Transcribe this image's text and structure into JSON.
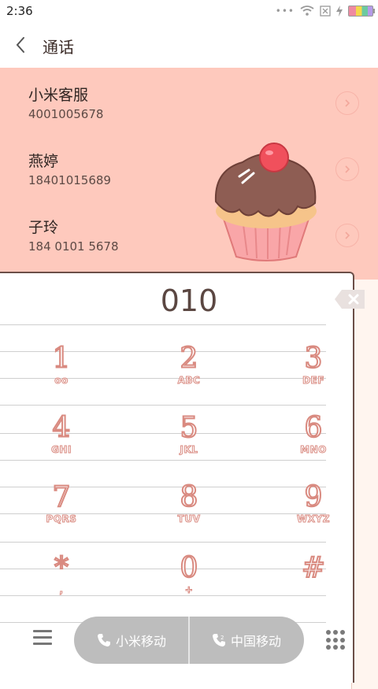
{
  "status_bar": {
    "time": "2:36",
    "more_dots": "•••"
  },
  "header": {
    "title": "通话"
  },
  "suggestions": [
    {
      "name": "小米客服",
      "number": "4001005678"
    },
    {
      "name": "燕婷",
      "number": "18401015689"
    },
    {
      "name": "子玲",
      "number": "184 0101 5678"
    }
  ],
  "dialer": {
    "input": "010",
    "keys": [
      {
        "digit": "1",
        "letters": "oo"
      },
      {
        "digit": "2",
        "letters": "ABC"
      },
      {
        "digit": "3",
        "letters": "DEF"
      },
      {
        "digit": "4",
        "letters": "GHI"
      },
      {
        "digit": "5",
        "letters": "JKL"
      },
      {
        "digit": "6",
        "letters": "MNO"
      },
      {
        "digit": "7",
        "letters": "PQRS"
      },
      {
        "digit": "8",
        "letters": "TUV"
      },
      {
        "digit": "9",
        "letters": "WXYZ"
      },
      {
        "digit": "*",
        "letters": ","
      },
      {
        "digit": "0",
        "letters": "+"
      },
      {
        "digit": "#",
        "letters": ""
      }
    ]
  },
  "bottom_bar": {
    "sim1_label": "小米移动",
    "sim2_label": "中国移动",
    "sim2_index": "2"
  },
  "colors": {
    "accent": "#fec9bd",
    "key_outline": "#d98a80",
    "call_bar": "#bdbdbd"
  },
  "icons": [
    "back-arrow-icon",
    "wifi-icon",
    "battery-icon",
    "chevron-right-icon",
    "delete-icon",
    "menu-icon",
    "phone-icon",
    "keypad-icon"
  ]
}
